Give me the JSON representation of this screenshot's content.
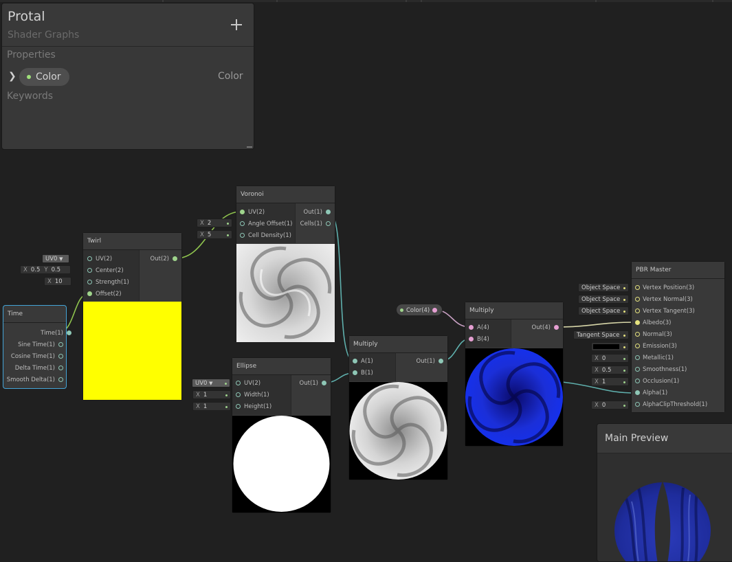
{
  "blackboard": {
    "title": "Protal",
    "subtitle": "Shader Graphs",
    "add_label": "+",
    "properties_label": "Properties",
    "property": {
      "name": "Color",
      "type": "Color"
    },
    "keywords_label": "Keywords"
  },
  "nodes": {
    "time": {
      "title": "Time",
      "outputs": [
        "Time(1)",
        "Sine Time(1)",
        "Cosine Time(1)",
        "Delta Time(1)",
        "Smooth Delta(1)"
      ]
    },
    "twirl": {
      "title": "Twirl",
      "inputs": [
        "UV(2)",
        "Center(2)",
        "Strength(1)",
        "Offset(2)"
      ],
      "output": "Out(2)",
      "uv_value": "UV0",
      "center_x_label": "X",
      "center_x": "0.5",
      "center_y_label": "Y",
      "center_y": "0.5",
      "strength_label": "X",
      "strength": "10",
      "preview_color": "#ffff00"
    },
    "voronoi": {
      "title": "Voronoi",
      "inputs": [
        "UV(2)",
        "Angle Offset(1)",
        "Cell Density(1)"
      ],
      "outputs": [
        "Out(1)",
        "Cells(1)"
      ],
      "angle_label": "X",
      "angle_offset": "2",
      "density_label": "X",
      "cell_density": "5"
    },
    "ellipse": {
      "title": "Ellipse",
      "inputs": [
        "UV(2)",
        "Width(1)",
        "Height(1)"
      ],
      "output": "Out(1)",
      "uv_value": "UV0",
      "width_label": "X",
      "width": "1",
      "height_label": "X",
      "height": "1"
    },
    "multiply1": {
      "title": "Multiply",
      "inputs": [
        "A(1)",
        "B(1)"
      ],
      "output": "Out(1)"
    },
    "color_prop": {
      "label": "Color(4)"
    },
    "multiply2": {
      "title": "Multiply",
      "inputs": [
        "A(4)",
        "B(4)"
      ],
      "output": "Out(4)"
    },
    "pbr": {
      "title": "PBR Master",
      "inputs": [
        "Vertex Position(3)",
        "Vertex Normal(3)",
        "Vertex Tangent(3)",
        "Albedo(3)",
        "Normal(3)",
        "Emission(3)",
        "Metallic(1)",
        "Smoothness(1)",
        "Occlusion(1)",
        "Alpha(1)",
        "AlphaClipThreshold(1)"
      ],
      "space1": "Object Space",
      "space2": "Object Space",
      "space3": "Object Space",
      "normal_space": "Tangent Space",
      "metallic_label": "X",
      "metallic": "0",
      "smoothness_label": "X",
      "smoothness": "0.5",
      "occlusion_label": "X",
      "occlusion": "1",
      "clip_label": "X",
      "alpha_clip": "0"
    }
  },
  "main_preview": {
    "title": "Main Preview"
  },
  "colors": {
    "background": "#202020",
    "node": "#393939",
    "port_vector": "#8ec7b6",
    "port_color": "#e59fd2",
    "port_vec3": "#e6e37f",
    "port_vec2": "#9fd48c",
    "selection": "#44a5d8",
    "tint": "#0000ff"
  }
}
